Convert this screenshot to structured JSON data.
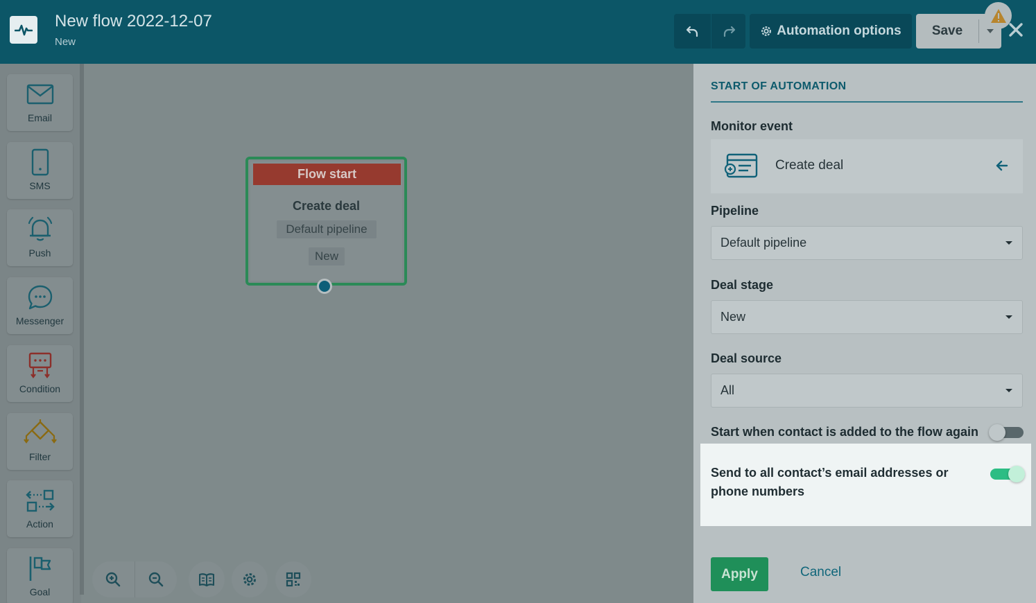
{
  "header": {
    "title": "New flow 2022-12-07",
    "subtitle": "New",
    "automation_options_label": "Automation options",
    "save_label": "Save"
  },
  "palette": [
    {
      "label": "Email",
      "icon": "email-icon",
      "color": "#1b5f6e"
    },
    {
      "label": "SMS",
      "icon": "sms-icon",
      "color": "#1b5f6e"
    },
    {
      "label": "Push",
      "icon": "push-icon",
      "color": "#1b5f6e"
    },
    {
      "label": "Messenger",
      "icon": "messenger-icon",
      "color": "#1b5f6e"
    },
    {
      "label": "Condition",
      "icon": "condition-icon",
      "color": "#8c2f2a"
    },
    {
      "label": "Filter",
      "icon": "filter-icon",
      "color": "#8a6a12"
    },
    {
      "label": "Action",
      "icon": "action-icon",
      "color": "#1b5f6e"
    },
    {
      "label": "Goal",
      "icon": "goal-icon",
      "color": "#1b5f6e"
    }
  ],
  "node": {
    "header": "Flow start",
    "event": "Create deal",
    "pipeline": "Default pipeline",
    "stage": "New"
  },
  "panel": {
    "section_title": "START OF AUTOMATION",
    "monitor_event_label": "Monitor event",
    "monitor_event_value": "Create deal",
    "pipeline_label": "Pipeline",
    "pipeline_value": "Default pipeline",
    "deal_stage_label": "Deal stage",
    "deal_stage_value": "New",
    "deal_source_label": "Deal source",
    "deal_source_value": "All",
    "restart_toggle_label": "Start when contact is added to the flow again",
    "restart_toggle_on": false,
    "send_all_label": "Send to all contact’s email addresses or phone numbers",
    "send_all_on": true
  },
  "footer": {
    "apply_label": "Apply",
    "cancel_label": "Cancel"
  },
  "colors": {
    "header_bg": "#0c5667",
    "node_header": "#963a2f",
    "node_border": "#2b8a57",
    "apply_bg": "#1f8f59",
    "toggle_on": "#2dbd84"
  }
}
